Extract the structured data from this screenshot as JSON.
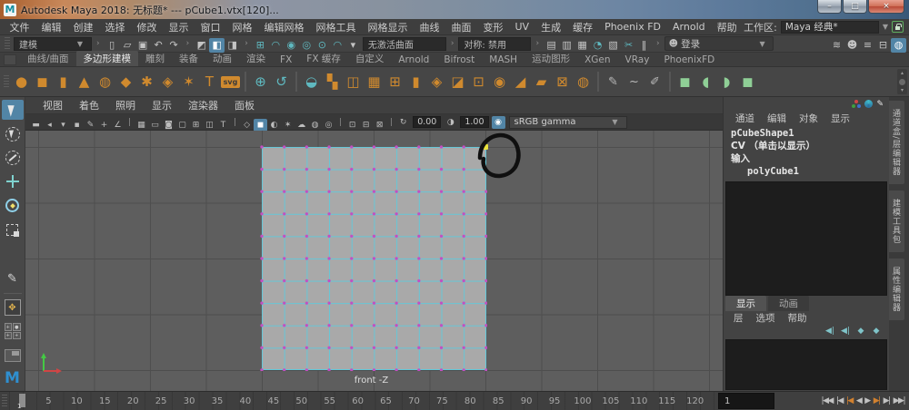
{
  "titlebar": {
    "title": "Autodesk Maya 2018: 无标题*   ---   pCube1.vtx[120]...",
    "logo_letter": "M",
    "minimize": "–",
    "maximize": "□",
    "close": "×"
  },
  "menubar": {
    "items": [
      "文件",
      "编辑",
      "创建",
      "选择",
      "修改",
      "显示",
      "窗口",
      "网格",
      "编辑网格",
      "网格工具",
      "网格显示",
      "曲线",
      "曲面",
      "变形",
      "UV",
      "生成",
      "缓存",
      "Phoenix FD",
      "Arnold",
      "帮助"
    ],
    "workspace_label": "工作区:",
    "workspace_value": "Maya 经典*",
    "dropdown_glyph": "▼"
  },
  "statusline": {
    "mode": "建模",
    "no_active_surface": "无激活曲面",
    "symmetry": "对称: 禁用",
    "login": "登录",
    "login_face": "☻",
    "file_icons": [
      {
        "name": "new-scene-icon",
        "glyph": "▯"
      },
      {
        "name": "open-scene-icon",
        "glyph": "▱"
      },
      {
        "name": "save-scene-icon",
        "glyph": "▣"
      },
      {
        "name": "undo-icon",
        "glyph": "↶"
      },
      {
        "name": "redo-icon",
        "glyph": "↷"
      }
    ],
    "select_mode_icons": [
      {
        "name": "select-hierarchy-icon",
        "glyph": "◩"
      },
      {
        "name": "select-object-icon",
        "glyph": "◧",
        "active": true
      },
      {
        "name": "select-component-icon",
        "glyph": "◨"
      }
    ],
    "snap_icons": [
      {
        "name": "snap-grid-icon",
        "glyph": "⊞",
        "color": "teal"
      },
      {
        "name": "snap-curve-icon",
        "glyph": "◠",
        "color": "teal"
      },
      {
        "name": "snap-point-icon",
        "glyph": "◉",
        "color": "teal"
      },
      {
        "name": "snap-projected-center-icon",
        "glyph": "◎",
        "color": "teal"
      },
      {
        "name": "snap-viewplane-icon",
        "glyph": "⊙",
        "color": "teal"
      },
      {
        "name": "make-live-icon",
        "glyph": "◠",
        "color": "teal"
      },
      {
        "name": "snap-options-arrow-icon",
        "glyph": "▾"
      }
    ],
    "render_icons": [
      {
        "name": "render-view-icon",
        "glyph": "▤"
      },
      {
        "name": "render-current-frame-icon",
        "glyph": "▥"
      },
      {
        "name": "ipr-render-icon",
        "glyph": "▦"
      },
      {
        "name": "render-settings-icon",
        "glyph": "◔",
        "color": "teal"
      },
      {
        "name": "hypershade-icon",
        "glyph": "▧"
      },
      {
        "name": "light-editor-icon",
        "glyph": "✂",
        "color": "teal"
      },
      {
        "name": "pause-viewport-icon",
        "glyph": "‖"
      }
    ],
    "right_icons": [
      {
        "name": "outliner-toggle-icon",
        "glyph": "≋"
      },
      {
        "name": "character-controls-icon",
        "glyph": "☻"
      },
      {
        "name": "pose-editor-icon",
        "glyph": "≡"
      },
      {
        "name": "editor-layout-icon",
        "glyph": "⊟"
      },
      {
        "name": "viewport-sphere-icon",
        "glyph": "◍",
        "active": true
      }
    ]
  },
  "shelf": {
    "tabs": [
      {
        "label": "曲线/曲面"
      },
      {
        "label": "多边形建模",
        "active": true
      },
      {
        "label": "雕刻"
      },
      {
        "label": "装备"
      },
      {
        "label": "动画"
      },
      {
        "label": "渲染"
      },
      {
        "label": "FX"
      },
      {
        "label": "FX 缓存"
      },
      {
        "label": "自定义"
      },
      {
        "label": "Arnold"
      },
      {
        "label": "Bifrost"
      },
      {
        "label": "MASH"
      },
      {
        "label": "运动图形"
      },
      {
        "label": "XGen"
      },
      {
        "label": "VRay"
      },
      {
        "label": "PhoenixFD"
      }
    ],
    "icons": [
      {
        "name": "poly-sphere-icon",
        "glyph": "●",
        "color": "orange"
      },
      {
        "name": "poly-cube-icon",
        "glyph": "◼",
        "color": "orange"
      },
      {
        "name": "poly-cylinder-icon",
        "glyph": "▮",
        "color": "orange"
      },
      {
        "name": "poly-cone-icon",
        "glyph": "▲",
        "color": "orange"
      },
      {
        "name": "poly-torus-icon",
        "glyph": "◍",
        "color": "orange"
      },
      {
        "name": "poly-plane-icon",
        "glyph": "◆",
        "color": "orange"
      },
      {
        "name": "poly-disc-icon",
        "glyph": "✱",
        "color": "orange",
        "bracket": true
      },
      {
        "name": "platonic-solid-icon",
        "glyph": "◈",
        "color": "orange",
        "bracket": true
      },
      {
        "name": "super-shapes-icon",
        "glyph": "✶",
        "color": "orange",
        "bracket": true
      },
      {
        "name": "poly-text-icon",
        "glyph": "T",
        "color": "orange"
      },
      {
        "name": "svg-tool-icon",
        "glyph": "svg",
        "color": "badge"
      },
      {
        "sep": true
      },
      {
        "name": "construction-aim-icon",
        "glyph": "⊕",
        "color": "teal"
      },
      {
        "name": "reset-coords-icon",
        "glyph": "↺",
        "color": "teal"
      },
      {
        "sep": true
      },
      {
        "name": "combine-icon",
        "glyph": "◒",
        "color": "teal"
      },
      {
        "name": "separate-icon",
        "glyph": "▚",
        "color": "orange"
      },
      {
        "name": "mirror-icon",
        "glyph": "◫",
        "color": "orange"
      },
      {
        "name": "fill-hole-icon",
        "glyph": "▦",
        "color": "orange"
      },
      {
        "name": "append-polygon-icon",
        "glyph": "⊞",
        "color": "orange"
      },
      {
        "name": "extrude-icon",
        "glyph": "▮",
        "color": "orange"
      },
      {
        "name": "smooth-icon",
        "glyph": "◈",
        "color": "orange"
      },
      {
        "name": "bevel-icon",
        "glyph": "◪",
        "color": "orange"
      },
      {
        "name": "bridge-icon",
        "glyph": "⊡",
        "color": "orange"
      },
      {
        "name": "circularize-icon",
        "glyph": "◉",
        "color": "orange"
      },
      {
        "name": "triangulate-icon",
        "glyph": "◢",
        "color": "orange"
      },
      {
        "name": "quadrangulate-icon",
        "glyph": "▰",
        "color": "orange"
      },
      {
        "name": "conform-icon",
        "glyph": "⊠",
        "color": "orange"
      },
      {
        "name": "reduce-icon",
        "glyph": "◍",
        "color": "orange",
        "bracket": true
      },
      {
        "sep": true
      },
      {
        "name": "ep-curve-icon",
        "glyph": "✎",
        "color": "gray"
      },
      {
        "name": "cv-curve-icon",
        "glyph": "~",
        "color": "gray"
      },
      {
        "name": "pencil-curve-icon",
        "glyph": "✐",
        "color": "gray"
      },
      {
        "sep": true
      },
      {
        "name": "quad-draw-icon",
        "glyph": "◼",
        "color": "green"
      },
      {
        "name": "sculpt-grab-icon",
        "glyph": "◖",
        "color": "green"
      },
      {
        "name": "sculpt-relax-icon",
        "glyph": "◗",
        "color": "green"
      },
      {
        "name": "sculpt-cube-icon",
        "glyph": "◼",
        "color": "green"
      }
    ],
    "scroll_up": "▴",
    "scroll_down": "▾"
  },
  "panel_menus": [
    "视图",
    "着色",
    "照明",
    "显示",
    "渲染器",
    "面板"
  ],
  "viewport": {
    "toolbar_left_icons": [
      {
        "name": "select-camera-icon",
        "glyph": "▬"
      },
      {
        "name": "lock-camera-icon",
        "glyph": "◂"
      },
      {
        "name": "camera-attributes-icon",
        "glyph": "▾"
      },
      {
        "name": "bookmarks-icon",
        "glyph": "▪"
      },
      {
        "name": "image-plane-icon",
        "glyph": "✎"
      },
      {
        "name": "pan-zoom-icon",
        "glyph": "+"
      },
      {
        "name": "grease-pencil-icon",
        "glyph": "∠"
      }
    ],
    "toolbar_gate_icons": [
      {
        "name": "grid-toggle-icon",
        "glyph": "▦"
      },
      {
        "name": "film-gate-icon",
        "glyph": "▭"
      },
      {
        "name": "resolution-gate-icon",
        "glyph": "◙"
      },
      {
        "name": "gate-mask-icon",
        "glyph": "▢"
      },
      {
        "name": "field-chart-icon",
        "glyph": "⊞"
      },
      {
        "name": "safe-action-icon",
        "glyph": "◫"
      },
      {
        "name": "safe-title-icon",
        "glyph": "T"
      }
    ],
    "toolbar_shading_icons": [
      {
        "name": "wireframe-icon",
        "glyph": "◇"
      },
      {
        "name": "smooth-shade-icon",
        "glyph": "◼",
        "active": true
      },
      {
        "name": "textured-icon",
        "glyph": "◐"
      },
      {
        "name": "use-all-lights-icon",
        "glyph": "✶"
      },
      {
        "name": "shadows-icon",
        "glyph": "☁"
      },
      {
        "name": "occlusion-icon",
        "glyph": "◍"
      },
      {
        "name": "motion-blur-icon",
        "glyph": "◎"
      }
    ],
    "toolbar_isolate_icons": [
      {
        "name": "isolate-select-icon",
        "glyph": "⊡"
      },
      {
        "name": "xray-icon",
        "glyph": "⊟"
      },
      {
        "name": "xray-joints-icon",
        "glyph": "⊠"
      }
    ],
    "exposure_icon_glyph": "↻",
    "exposure_value": "0.00",
    "gamma_icon_glyph": "◑",
    "gamma_value": "1.00",
    "view_transform_icon_glyph": "◉",
    "view_transform": "sRGB gamma",
    "camera_label": "front -Z"
  },
  "channel_box": {
    "menus": [
      "通道",
      "编辑",
      "对象",
      "显示"
    ],
    "shape_node": "pCubeShape1",
    "component_line": "CV （单击以显示）",
    "inputs_label": "输入",
    "input_node": "polyCube1"
  },
  "layer_editor": {
    "tabs": [
      {
        "label": "显示",
        "active": true
      },
      {
        "label": "动画"
      }
    ],
    "menus": [
      "层",
      "选项",
      "帮助"
    ],
    "buttons": [
      {
        "name": "new-empty-layer-icon",
        "glyph": "◀|"
      },
      {
        "name": "new-layer-icon",
        "glyph": "◀|"
      },
      {
        "name": "new-layer-from-selected-icon",
        "glyph": "◆"
      },
      {
        "name": "new-layer-options-icon",
        "glyph": "◆"
      }
    ]
  },
  "side_tabs": [
    "通道盒/层编辑器",
    "建模工具包",
    "属性编辑器"
  ],
  "timeline": {
    "ticks": [
      "5",
      "10",
      "15",
      "20",
      "25",
      "30",
      "35",
      "40",
      "45",
      "50",
      "55",
      "60",
      "65",
      "70",
      "75",
      "80",
      "85",
      "90",
      "95",
      "100",
      "105",
      "110",
      "115",
      "120"
    ],
    "start_marker_label": "1",
    "current_frame": "1",
    "playback": [
      {
        "name": "go-to-start-button",
        "glyph": "|◀◀"
      },
      {
        "name": "step-back-frame-button",
        "glyph": "|◀"
      },
      {
        "name": "step-back-key-button",
        "glyph": "|◀",
        "color": "orange"
      },
      {
        "name": "play-backwards-button",
        "glyph": "◀"
      },
      {
        "name": "play-forwards-button",
        "glyph": "▶"
      },
      {
        "name": "step-forward-key-button",
        "glyph": "▶|",
        "color": "orange"
      },
      {
        "name": "step-forward-frame-button",
        "glyph": "▶|"
      },
      {
        "name": "go-to-end-button",
        "glyph": "▶▶|"
      }
    ]
  },
  "colors": {
    "accent_blue": "#5285a6",
    "shelf_orange": "#d08a2e",
    "icon_teal": "#5fb9c0",
    "quad_green": "#8fcf96",
    "wire_cyan": "#62c8da",
    "vertex_magenta": "#c24fc2",
    "selected_vertex_yellow": "#ece43c",
    "viewport_gray": "#5e5e5e",
    "plane_gray": "#a9a9a9"
  }
}
